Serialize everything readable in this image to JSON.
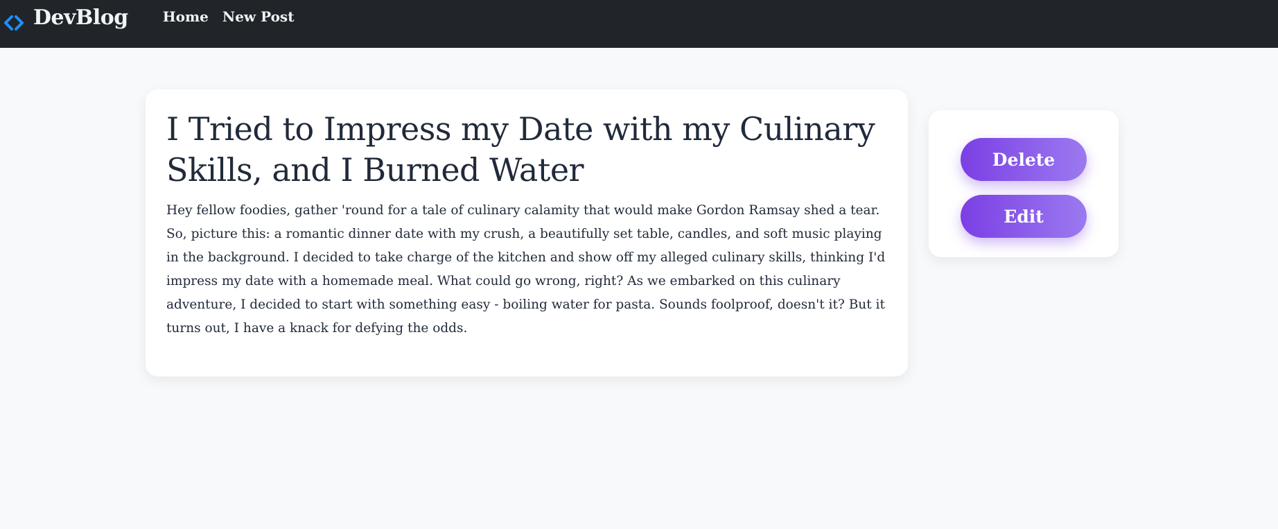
{
  "navbar": {
    "brand": "DevBlog",
    "brand_icon": "code-brackets-icon",
    "links": [
      "Home",
      "New Post"
    ]
  },
  "post": {
    "title": "I Tried to Impress my Date with my Culinary Skills, and I Burned Water",
    "body": "Hey fellow foodies, gather 'round for a tale of culinary calamity that would make Gordon Ramsay shed a tear. So, picture this: a romantic dinner date with my crush, a beautifully set table, candles, and soft music playing in the background. I decided to take charge of the kitchen and show off my alleged culinary skills, thinking I'd impress my date with a homemade meal. What could go wrong, right? As we embarked on this culinary adventure, I decided to start with something easy - boiling water for pasta. Sounds foolproof, doesn't it? But it turns out, I have a knack for defying the odds."
  },
  "actions": {
    "delete_label": "Delete",
    "edit_label": "Edit"
  },
  "colors": {
    "navbar_bg": "#212529",
    "accent_start": "#7b3fe4",
    "accent_end": "#9b7af0",
    "brand_icon": "#1e90ff"
  }
}
